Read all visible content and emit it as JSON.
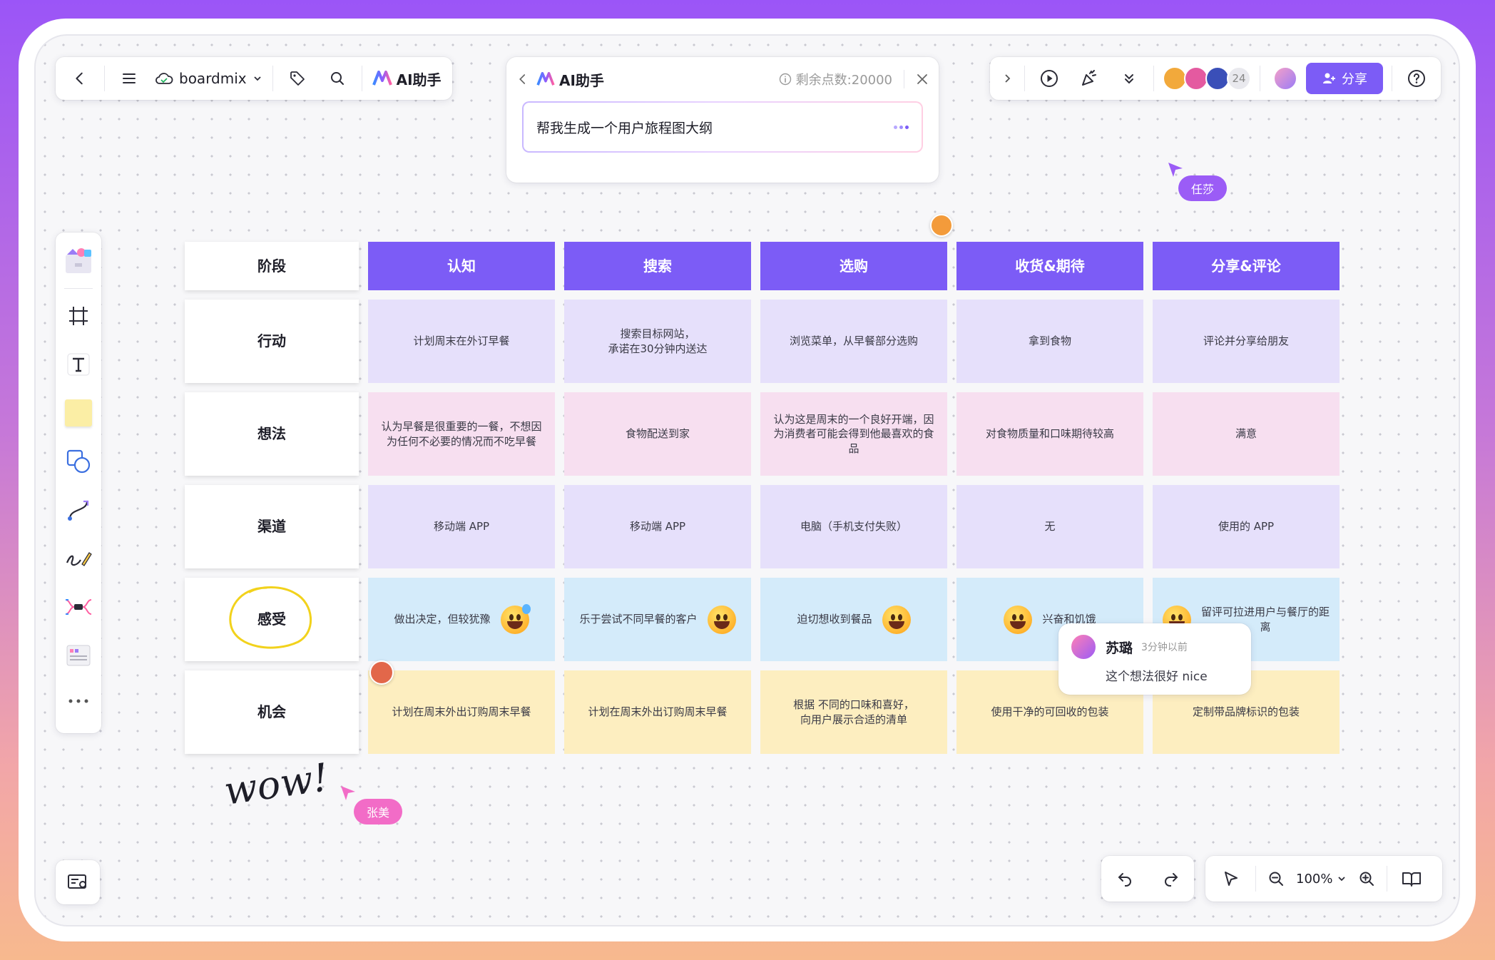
{
  "toolbar_left": {
    "board_name": "boardmix",
    "ai_label": "AI助手"
  },
  "ai_panel": {
    "title": "AI助手",
    "credits": "剩余点数:20000",
    "prompt": "帮我生成一个用户旅程图大纲"
  },
  "toolbar_right": {
    "collaborator_count": "24",
    "share_label": "分享"
  },
  "journey": {
    "corner": "阶段",
    "stages": [
      "认知",
      "搜索",
      "选购",
      "收货&期待",
      "分享&评论"
    ],
    "rows": [
      {
        "label": "行动",
        "cells": [
          "计划周末在外订早餐",
          "搜索目标网站，\n承诺在30分钟内送达",
          "浏览菜单，从早餐部分选购",
          "拿到食物",
          "评论并分享给朋友"
        ]
      },
      {
        "label": "想法",
        "cells": [
          "认为早餐是很重要的一餐，不想因为任何不必要的情况而不吃早餐",
          "食物配送到家",
          "认为这是周末的一个良好开端，因为消费者可能会得到他最喜欢的食品",
          "对食物质量和口味期待较高",
          "满意"
        ]
      },
      {
        "label": "渠道",
        "cells": [
          "移动端 APP",
          "移动端 APP",
          "电脑（手机支付失败）",
          "无",
          "使用的 APP"
        ]
      },
      {
        "label": "感受",
        "cells": [
          "做出决定，但较犹豫",
          "乐于尝试不同早餐的客户",
          "迫切想收到餐品",
          "兴奋和饥饿",
          "留评可拉进用户与餐厅的距离"
        ]
      },
      {
        "label": "机会",
        "cells": [
          "计划在周末外出订购周末早餐",
          "计划在周末外出订购周末早餐",
          "根据 不同的口味和喜好，\n向用户展示合适的清单",
          "使用干净的可回收的包装",
          "定制带品牌标识的包装"
        ]
      }
    ]
  },
  "comment": {
    "author": "苏璐",
    "time": "3分钟以前",
    "text": "这个想法很好 nice"
  },
  "cursors": {
    "renshai": "任莎",
    "zhangmei": "张美"
  },
  "handwriting": "wow!",
  "zoom": "100%",
  "colors": {
    "accent": "#7c5cf6",
    "action_row": "#e6e0fb",
    "thought_row": "#f7dff0",
    "feeling_row": "#d4ebfa",
    "opportunity_row": "#fdeec0"
  }
}
